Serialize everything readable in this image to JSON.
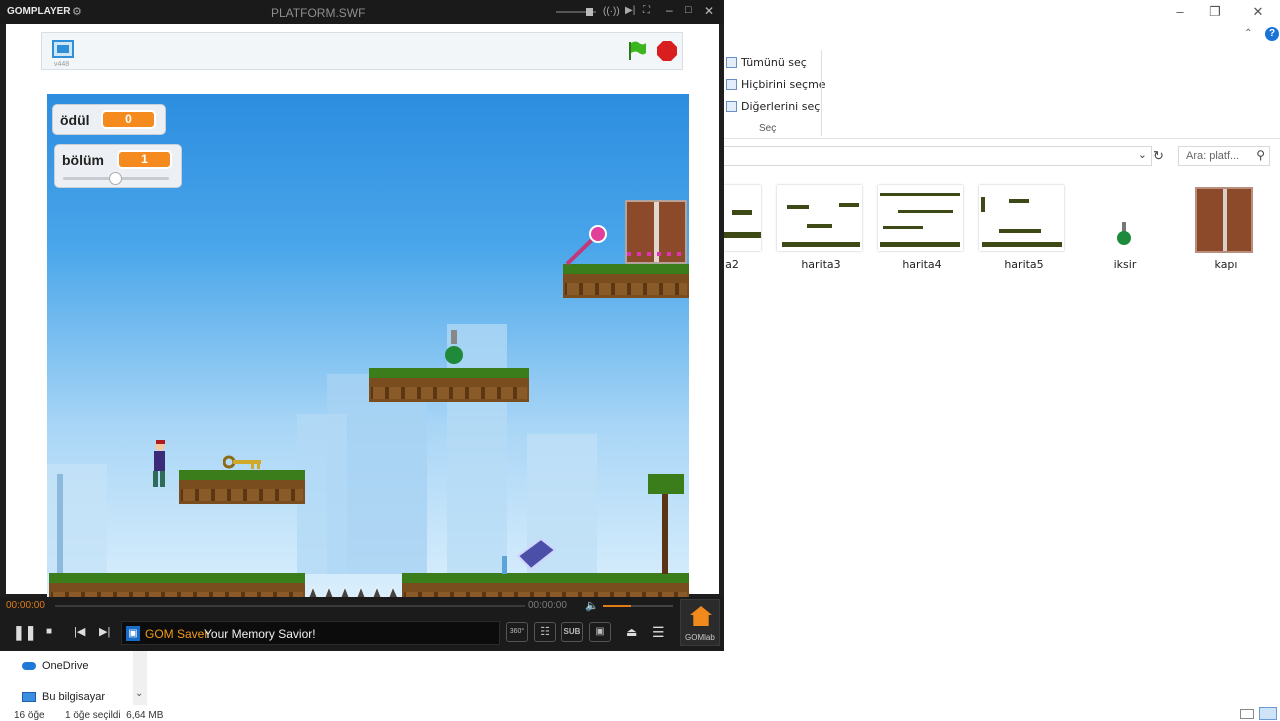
{
  "explorer": {
    "ribbon": {
      "select_all": "Tümünü seç",
      "select_none": "Hiçbirini seçme",
      "invert": "Diğerlerini seç",
      "group": "Seç"
    },
    "search_placeholder": "Ara: platf...",
    "files": [
      {
        "label": "a2"
      },
      {
        "label": "harita3"
      },
      {
        "label": "harita4"
      },
      {
        "label": "harita5"
      },
      {
        "label": "iksir"
      },
      {
        "label": "kapı"
      }
    ],
    "nav": {
      "onedrive": "OneDrive",
      "thispc": "Bu bilgisayar"
    },
    "status": {
      "count": "16 öğe",
      "selected": "1 öğe seçildi  6,64 MB"
    }
  },
  "gom": {
    "brand": "GOMPLAYER",
    "title": "PLATFORM.SWF",
    "version": "v448",
    "monitors": {
      "reward_label": "ödül",
      "reward_value": "0",
      "level_label": "bölüm",
      "level_value": "1",
      "level_slider": 0.5
    },
    "time_current": "00:00:00",
    "time_total": "00:00:00",
    "volume": 0.4,
    "ad_prefix": "GOM Saver",
    "ad_text": "Your Memory Savior!",
    "sub_label": "SUB",
    "deg_label": "360°",
    "lab_label": "GOMlab",
    "colors": {
      "accent": "#f58a1e",
      "grass": "#3b7d1a",
      "sky": "#4aa6ea"
    }
  }
}
